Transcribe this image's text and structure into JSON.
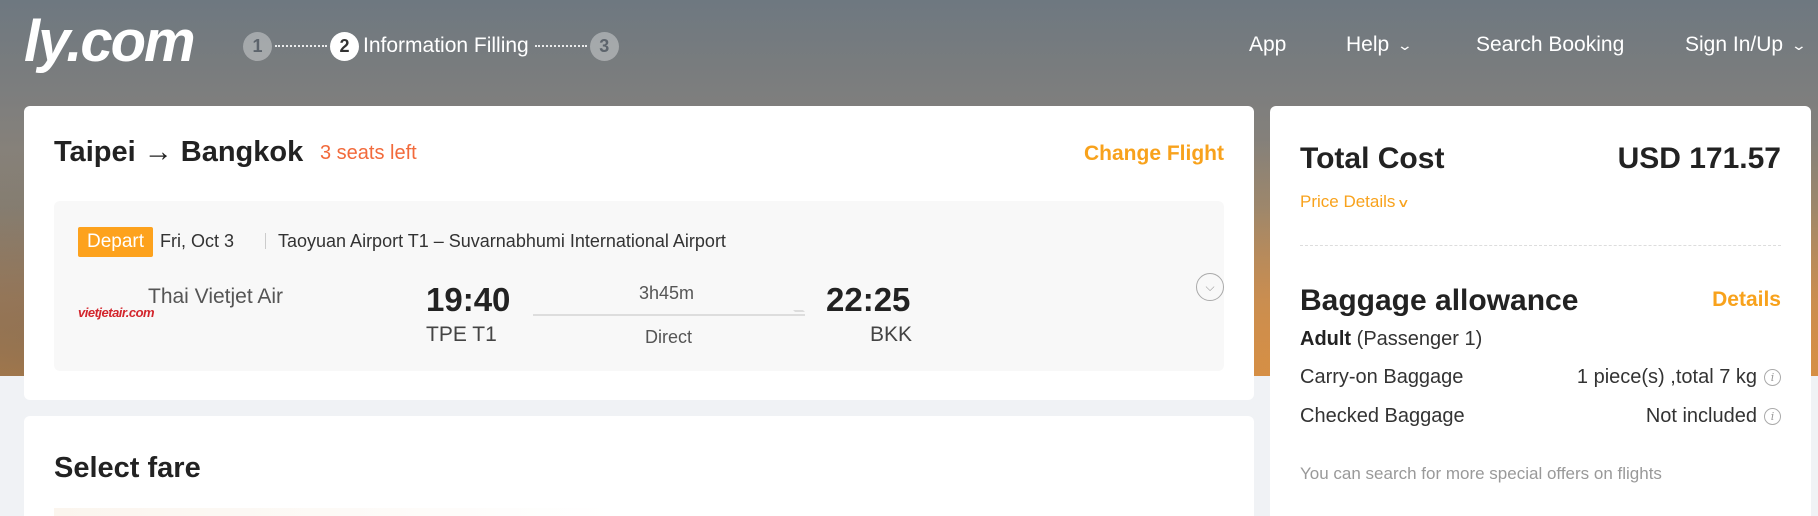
{
  "header": {
    "logo": "ly.com",
    "steps": [
      {
        "number": "1",
        "label": ""
      },
      {
        "number": "2",
        "label": "Information Filling"
      },
      {
        "number": "3",
        "label": ""
      }
    ],
    "nav": {
      "app": "App",
      "help": "Help",
      "search_booking": "Search Booking",
      "sign_in": "Sign In/Up"
    }
  },
  "flight": {
    "route": "Taipei → Bangkok",
    "seats_left": "3 seats left",
    "change_flight": "Change Flight",
    "depart_tag": "Depart",
    "date": "Fri, Oct 3",
    "airports": "Taoyuan Airport T1 – Suvarnabhumi International Airport",
    "airline_logo_text": "vietjetair.com",
    "airline": "Thai Vietjet Air",
    "dep_time": "19:40",
    "dep_code": "TPE T1",
    "duration": "3h45m",
    "stops": "Direct",
    "arr_time": "22:25",
    "arr_code": "BKK"
  },
  "fare": {
    "title": "Select fare"
  },
  "cost": {
    "title": "Total Cost",
    "value": "USD 171.57",
    "price_details": "Price Details",
    "baggage_title": "Baggage allowance",
    "baggage_details": "Details",
    "passenger_type": "Adult",
    "passenger_note": "(Passenger 1)",
    "carry_on_label": "Carry-on Baggage",
    "carry_on_value": "1 piece(s) ,total 7 kg",
    "checked_label": "Checked Baggage",
    "checked_value": "Not included",
    "note": "You can search for more special offers on flights"
  },
  "colors": {
    "accent": "#f8a21c",
    "seats": "#f26a3b",
    "depart_tag": "#fda21d"
  }
}
